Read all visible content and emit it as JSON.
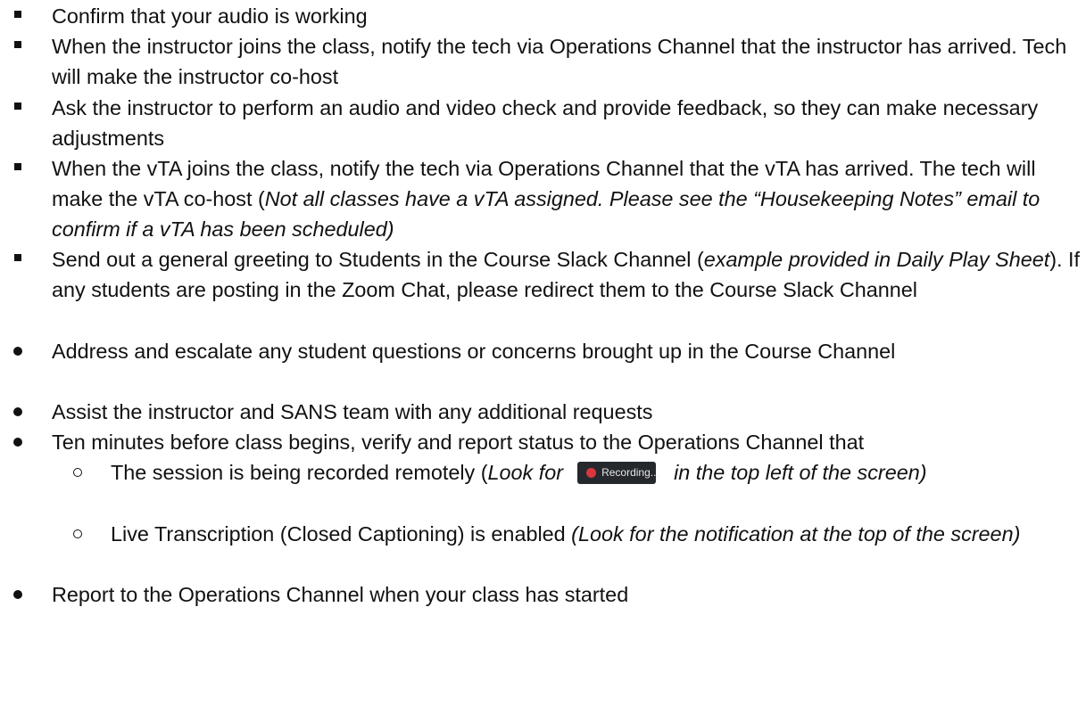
{
  "items": [
    {
      "text": "Confirm that your audio is working"
    },
    {
      "text": "When the instructor joins the class, notify the tech via Operations Channel that the instructor has arrived. Tech will make the instructor co-host"
    },
    {
      "text": "Ask the instructor to perform an audio and video check and provide feedback, so they can make necessary adjustments"
    },
    {
      "text_a": "When the vTA joins the class, notify the tech via Operations Channel that the vTA has arrived. The tech will make the vTA co-host (",
      "italic": "Not all classes have a vTA assigned. Please see the “Housekeeping Notes” email to confirm if a vTA has been scheduled)"
    },
    {
      "text_a": "Send out a general greeting to Students in the Course Slack Channel (",
      "italic": "example provided in Daily Play Sheet",
      "text_b": "). If any students are posting in the Zoom Chat, please redirect them to the Course Slack Channel"
    },
    {
      "text": "Address and escalate any student questions or concerns brought up in the Course Channel"
    },
    {
      "text": "Assist the instructor and SANS team with any additional requests"
    },
    {
      "text": "Ten minutes before class begins, verify and report status to the Operations Channel that"
    },
    {
      "text": "Report to the Operations Channel when your class has started"
    }
  ],
  "subitems": [
    {
      "text_a": "The session is being recorded remotely (",
      "italic_a": "Look for",
      "italic_b": "in the top left of the screen)"
    },
    {
      "text_a": "Live Transcription (Closed Captioning) is enabled ",
      "italic": "(Look for the notification at the top of the screen)"
    }
  ],
  "recording_badge": {
    "label": "Recording...",
    "icon": "record-dot-icon",
    "bg": "#25282c",
    "dot_color": "#d9363e"
  }
}
